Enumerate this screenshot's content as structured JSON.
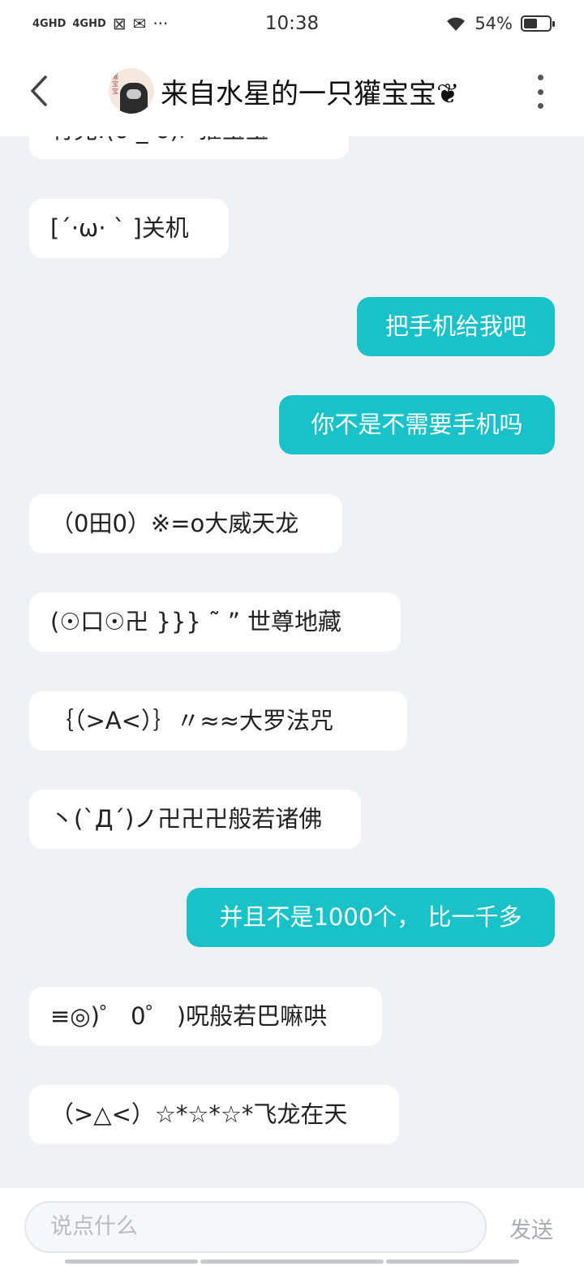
{
  "status_bar": {
    "signal1": "4GHD",
    "signal2": "4GHD",
    "time": "10:38",
    "battery": "54%",
    "battery_level": 0.54,
    "more": "···"
  },
  "header": {
    "title": "来自水星的一只獾宝宝❦",
    "avatar_text": "獾宝宝"
  },
  "messages": [
    {
      "side": "in",
      "text": "有兜:(ò _ ó)ﾉ 獾宝宝~"
    },
    {
      "side": "in",
      "text": "[ˊ·ω· ˋ ]关机"
    },
    {
      "side": "out",
      "text": "把手机给我吧"
    },
    {
      "side": "out",
      "text": "你不是不需要手机吗"
    },
    {
      "side": "in",
      "text": "（0田0）※=o大威天龙"
    },
    {
      "side": "in",
      "text": "(☉口☉卍 }}} ˜ ” 世尊地藏"
    },
    {
      "side": "in",
      "text": "｛（>A<）｝〃≈≈大罗法咒"
    },
    {
      "side": "in",
      "text": "丶(ˋДˊ)ノ卍卍卍般若诸佛"
    },
    {
      "side": "out",
      "text": "并且不是1000个， 比一千多"
    },
    {
      "side": "in",
      "text": "≡◎)゜ 0゜ )呪般若巴嘛哄"
    },
    {
      "side": "in",
      "text": "（>△<）☆*☆*☆*飞龙在天"
    }
  ],
  "composer": {
    "placeholder": "说点什么",
    "send_label": "发送"
  },
  "colors": {
    "outgoing_bubble": "#19c2c9",
    "incoming_bubble": "#ffffff",
    "background": "#eff1f5"
  }
}
